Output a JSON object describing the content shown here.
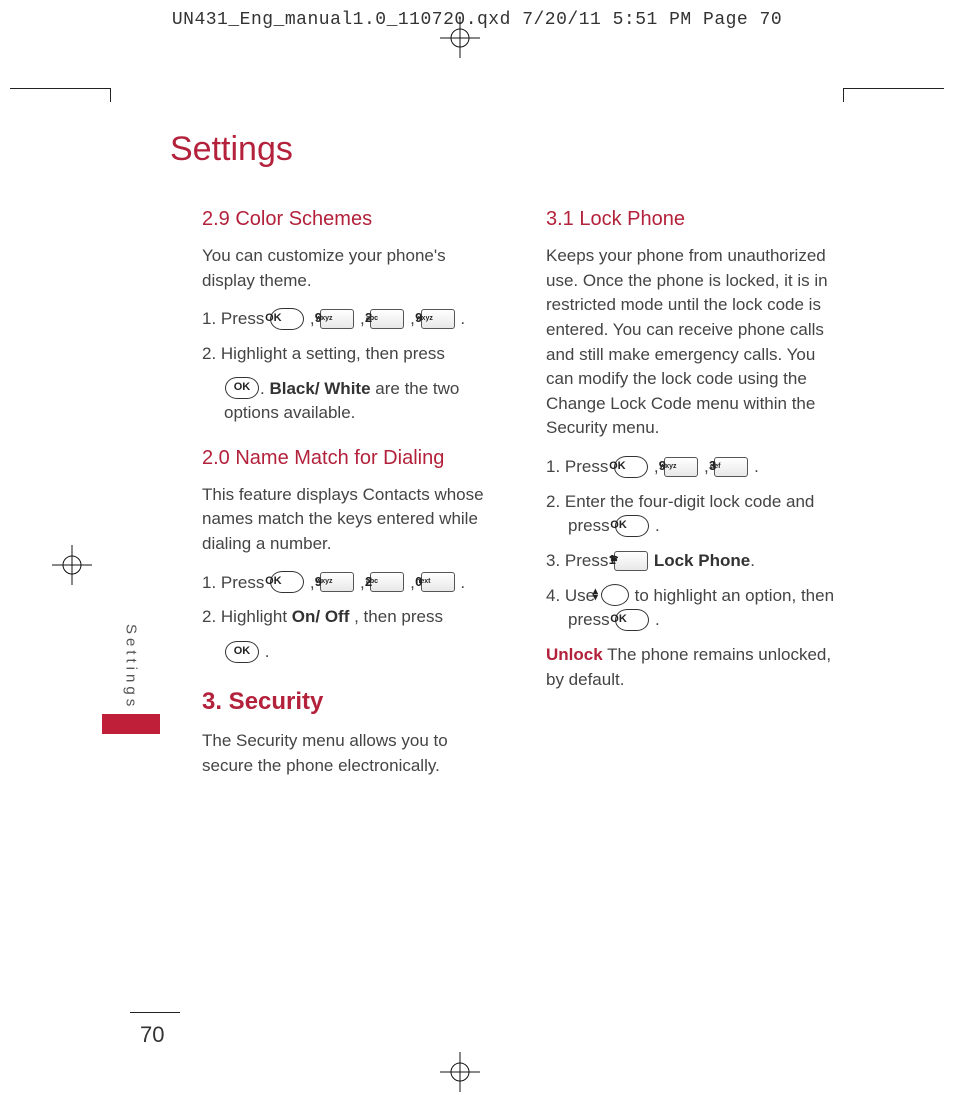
{
  "print_header": "UN431_Eng_manual1.0_110720.qxd  7/20/11  5:51 PM  Page 70",
  "page_title": "Settings",
  "side_label": "Settings",
  "page_number": "70",
  "keys": {
    "ok": "OK",
    "k9": {
      "big": "9",
      "sm": "wxyz"
    },
    "k2": {
      "big": "2",
      "sm": "abc"
    },
    "k0": {
      "big": "0",
      "sm": "next"
    },
    "k3": {
      "big": "3",
      "sm": "def"
    },
    "k1": {
      "big": "1",
      "sm": ""
    }
  },
  "left": {
    "s29_title": "2.9 Color Schemes",
    "s29_p": "You can customize your phone's display theme.",
    "s29_step1a": "1. Press ",
    "s29_step2a": "2. Highlight a setting, then press",
    "s29_step2b": ". ",
    "s29_step2c": "Black/ White",
    "s29_step2d": " are the two options available.",
    "s20_title": "2.0 Name Match for Dialing",
    "s20_p": "This feature displays Contacts whose names match the keys entered while dialing a number.",
    "s20_step1a": "1. Press ",
    "s20_step2a": "2. Highlight ",
    "s20_step2b": "On/ Off",
    "s20_step2c": " , then press",
    "s3_title": "3. Security",
    "s3_p": "The Security menu allows you to secure the phone electronically."
  },
  "right": {
    "s31_title": "3.1 Lock Phone",
    "s31_p": "Keeps your phone from unauthorized use. Once the phone is locked, it is in restricted mode until the lock code is entered. You can receive phone calls and still make emergency calls. You can modify the lock code using the Change Lock Code menu within the Security menu.",
    "s31_step1a": "1. Press ",
    "s31_step2a": "2. Enter the four-digit lock code and press ",
    "s31_step3a": "3. Press ",
    "s31_step3b": " Lock Phone",
    "s31_step4a": "4. Use ",
    "s31_step4b": " to highlight an option, then press ",
    "unlock_label": "Unlock",
    "unlock_text": "  The phone remains unlocked, by default."
  }
}
